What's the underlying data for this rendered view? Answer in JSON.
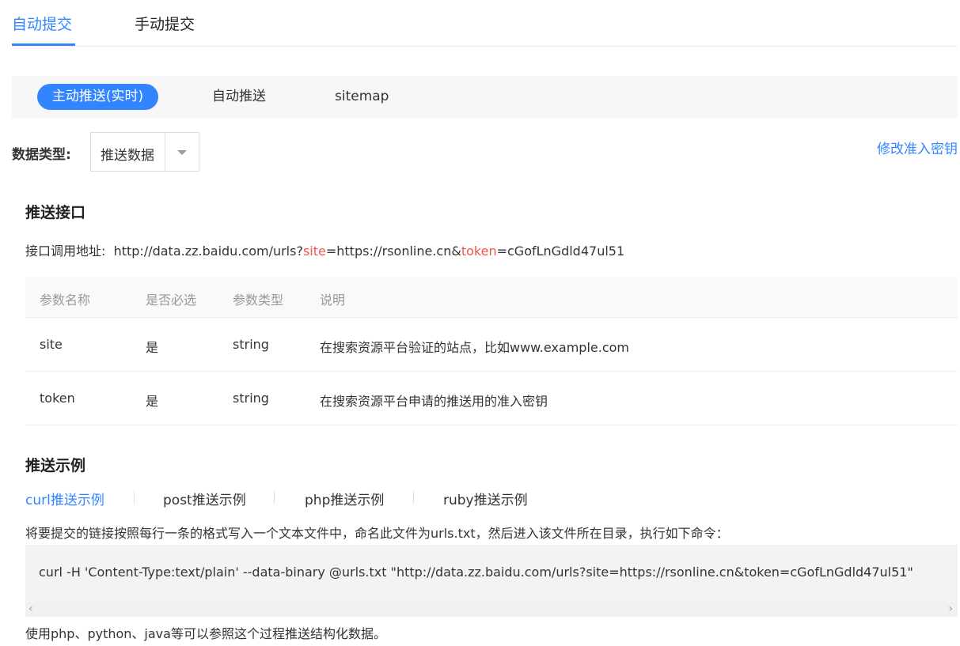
{
  "top_tabs": {
    "auto": "自动提交",
    "manual": "手动提交"
  },
  "sub_tabs": {
    "active": "主动推送(实时)",
    "auto_push": "自动推送",
    "sitemap": "sitemap"
  },
  "data_type": {
    "label": "数据类型:",
    "value": "推送数据",
    "modify_link": "修改准入密钥"
  },
  "push_api": {
    "heading": "推送接口",
    "label": "接口调用地址:",
    "url_prefix": "http://data.zz.baidu.com/urls?",
    "param_site": "site",
    "site_value": "=https://rsonline.cn&",
    "param_token": "token",
    "token_value": "=cGofLnGdld47ul51"
  },
  "param_table": {
    "headers": [
      "参数名称",
      "是否必选",
      "参数类型",
      "说明"
    ],
    "rows": [
      [
        "site",
        "是",
        "string",
        "在搜索资源平台验证的站点，比如www.example.com"
      ],
      [
        "token",
        "是",
        "string",
        "在搜索资源平台申请的推送用的准入密钥"
      ]
    ]
  },
  "examples": {
    "heading": "推送示例",
    "tabs": [
      "curl推送示例",
      "post推送示例",
      "php推送示例",
      "ruby推送示例"
    ],
    "description": "将要提交的链接按照每行一条的格式写入一个文本文件中，命名此文件为urls.txt，然后进入该文件所在目录，执行如下命令：",
    "code": "curl -H 'Content-Type:text/plain' --data-binary @urls.txt \"http://data.zz.baidu.com/urls?site=https://rsonline.cn&token=cGofLnGdld47ul51\"",
    "footer": "使用php、python、java等可以参照这个过程推送结构化数据。"
  },
  "colors": {
    "accent": "#3385ff",
    "param_highlight": "#f0554a"
  }
}
